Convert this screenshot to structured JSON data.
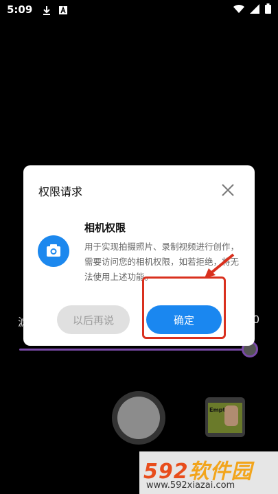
{
  "status_bar": {
    "time": "5:09",
    "icons": [
      "download-icon",
      "font-icon",
      "wifi-icon",
      "signal-icon",
      "battery-icon"
    ]
  },
  "camera": {
    "slider_left_label": "滤",
    "slider_right_label": "0",
    "thumbnail_text": "Empty"
  },
  "dialog": {
    "title": "权限请求",
    "permission_title": "相机权限",
    "permission_desc": "用于实现拍摄照片、录制视频进行创作，需要访问您的相机权限，如若拒绝，将无法使用上述功能。",
    "later_button": "以后再说",
    "ok_button": "确定"
  },
  "watermark": {
    "num": "592",
    "cn": "软件园",
    "url": "www.592xiazai.com"
  },
  "colors": {
    "accent": "#1a87f0",
    "highlight": "#d9301e",
    "slider": "#7a4aa8"
  }
}
